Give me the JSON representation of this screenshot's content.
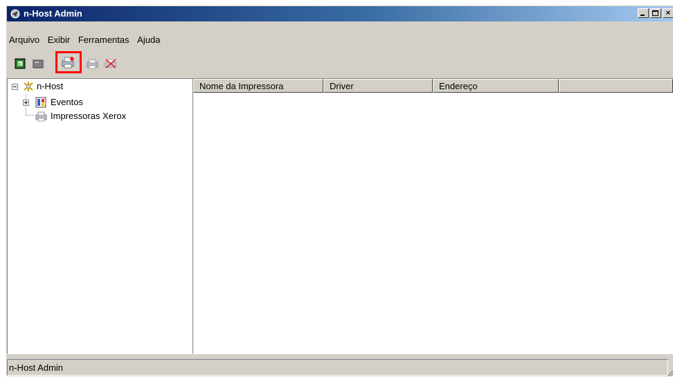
{
  "window": {
    "title": "n-Host Admin"
  },
  "menu": [
    "Arquivo",
    "Exibir",
    "Ferramentas",
    "Ajuda"
  ],
  "toolbar": {
    "items": [
      "refresh-icon",
      "host-icon",
      "add-printer-icon",
      "printer-icon",
      "delete-printer-icon"
    ],
    "highlighted": "add-printer-icon"
  },
  "tree": {
    "root": "n-Host",
    "children": [
      "Eventos",
      "Impressoras Xerox"
    ]
  },
  "list": {
    "columns": [
      "Nome da Impressora",
      "Driver",
      "Endereço",
      ""
    ]
  },
  "status": {
    "text": "n-Host Admin"
  },
  "colors": {
    "highlight": "#ff0000",
    "title_start": "#0a246a",
    "title_end": "#a6caf0"
  }
}
